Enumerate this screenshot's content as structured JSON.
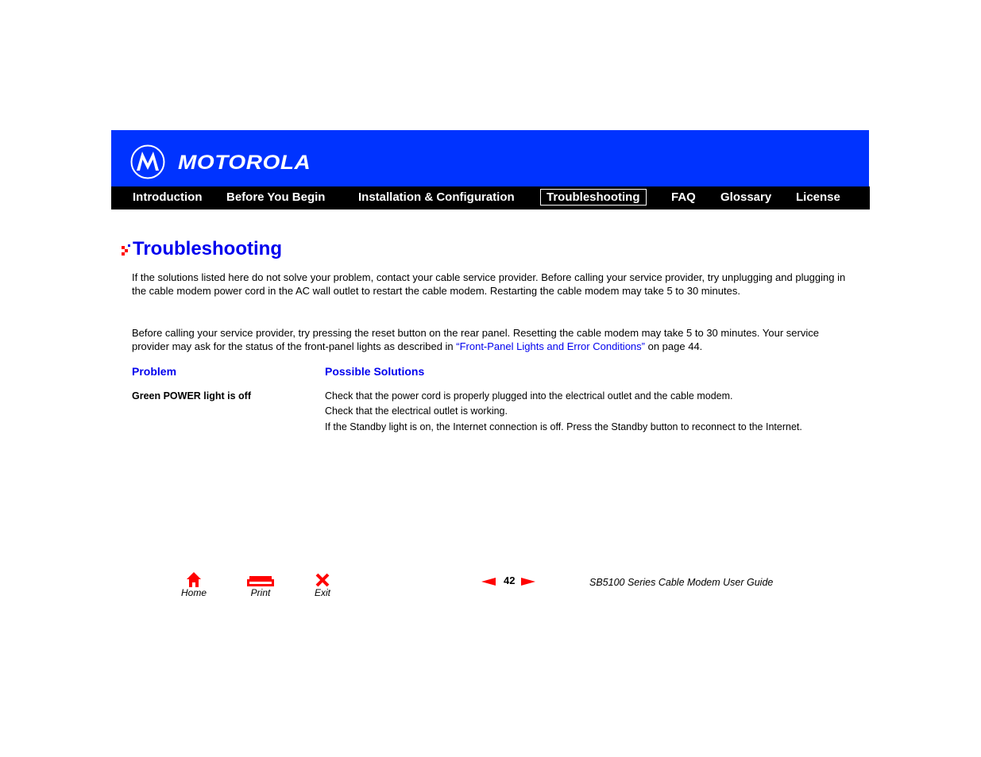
{
  "header": {
    "brand": "MOTOROLA",
    "brand_color": "#0033ff",
    "logo_icon": "motorola-batwing-logo"
  },
  "nav": {
    "items": [
      {
        "label": "Introduction",
        "active": false
      },
      {
        "label": "Before You Begin",
        "active": false
      },
      {
        "label": "Installation & Configuration",
        "active": false
      },
      {
        "label": "Troubleshooting",
        "active": true
      },
      {
        "label": "FAQ",
        "active": false
      },
      {
        "label": "Glossary",
        "active": false
      },
      {
        "label": "License",
        "active": false
      }
    ]
  },
  "main": {
    "title": "Troubleshooting",
    "title_color": "#0000ee",
    "title_icon": "red-arrow-bullet",
    "paragraph1": "If the solutions listed here do not solve your problem, contact your cable service provider. Before calling your service provider, try unplugging and plugging in the cable modem power cord in the AC wall outlet to restart the cable modem. Restarting the cable modem may take 5 to 30 minutes.",
    "paragraph2_before": "Before calling your service provider, try pressing the reset button on the rear panel. Resetting the cable modem may take 5 to 30 minutes. Your service provider may ask for the status of the front-panel lights as described in ",
    "paragraph2_link": "“Front-Panel Lights and Error Conditions”",
    "paragraph2_after": " on page 44.",
    "table": {
      "headers": [
        "Problem",
        "Possible Solutions"
      ],
      "rows": [
        {
          "problem": "Green POWER light is off",
          "solutions": [
            "Check that the power cord is properly plugged into the electrical outlet and the cable modem.",
            "Check that the electrical outlet is working.",
            "If the Standby light is on, the Internet connection is off. Press the Standby button to reconnect to the Internet."
          ]
        }
      ]
    }
  },
  "footer": {
    "buttons": [
      {
        "label": "Home",
        "icon": "home-icon"
      },
      {
        "label": "Print",
        "icon": "printer-icon"
      },
      {
        "label": "Exit",
        "icon": "close-x-icon"
      }
    ],
    "page_number": "42",
    "guide_title": "SB5100 Series Cable Modem User Guide",
    "accent_color": "#ff0000"
  }
}
